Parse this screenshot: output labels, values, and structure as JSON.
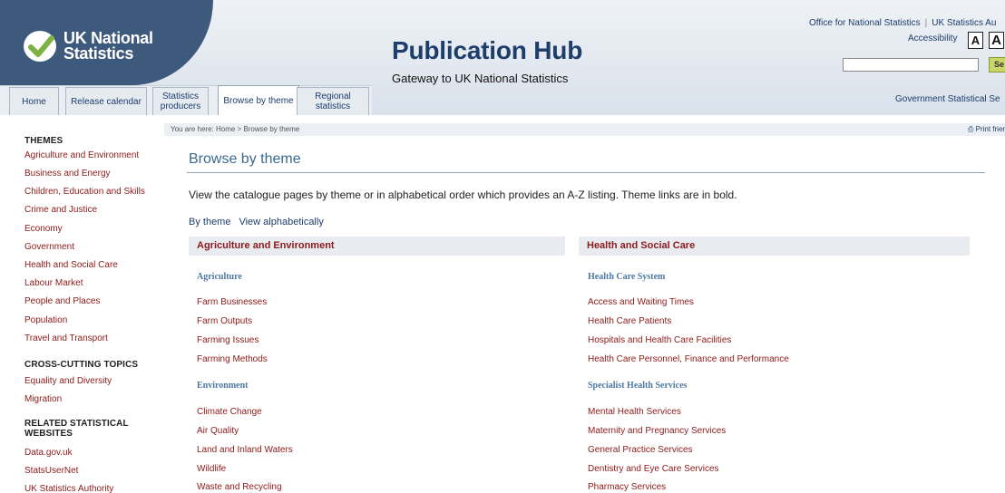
{
  "header": {
    "logo_line1": "UK National",
    "logo_line2": "Statistics",
    "title": "Publication Hub",
    "subtitle": "Gateway to UK National Statistics",
    "top_link_ons": "Office for National Statistics",
    "top_link_uksa": "UK Statistics Au",
    "accessibility_label": "Accessibility",
    "font_small": "A",
    "font_large": "A",
    "search_value": "",
    "search_button": "Se",
    "gss_link": "Government Statistical Se"
  },
  "tabs": [
    {
      "label": "Home"
    },
    {
      "label": "Release calendar"
    },
    {
      "label": "Statistics producers"
    },
    {
      "label": "Browse by theme"
    },
    {
      "label": "Regional statistics"
    }
  ],
  "sidebar": {
    "themes_heading": "THEMES",
    "themes": [
      "Agriculture and Environment",
      "Business and Energy",
      "Children, Education and Skills",
      "Crime and Justice",
      "Economy",
      "Government",
      "Health and Social Care",
      "Labour Market",
      "People and Places",
      "Population",
      "Travel and Transport"
    ],
    "cross_heading": "CROSS-CUTTING TOPICS",
    "cross": [
      "Equality and Diversity",
      "Migration"
    ],
    "related_heading_1": "RELATED STATISTICAL",
    "related_heading_2": "WEBSITES",
    "related": [
      "Data.gov.uk",
      "StatsUserNet",
      "UK Statistics Authority"
    ]
  },
  "main": {
    "breadcrumb": "You are here: Home > Browse by theme",
    "print_link": "Print frien",
    "page_title": "Browse by theme",
    "intro": "View the catalogue pages by theme or in alphabetical order which provides an A-Z listing. Theme links are in bold.",
    "view_by_theme": "By theme",
    "view_alpha": "View alphabetically",
    "col1": {
      "heading": "Agriculture and Environment",
      "groups": [
        {
          "title": "Agriculture",
          "items": [
            "Farm Businesses",
            "Farm Outputs",
            "Farming Issues",
            "Farming Methods"
          ]
        },
        {
          "title": "Environment",
          "items": [
            "Climate Change",
            "Air Quality",
            "Land and Inland Waters",
            "Wildlife",
            "Waste and Recycling"
          ]
        }
      ]
    },
    "col2": {
      "heading": "Health and Social Care",
      "groups": [
        {
          "title": "Health Care System",
          "items": [
            "Access and Waiting Times",
            "Health Care Patients",
            "Hospitals and Health Care Facilities",
            "Health Care Personnel, Finance and Performance"
          ]
        },
        {
          "title": "Specialist Health Services",
          "items": [
            "Mental Health Services",
            "Maternity and Pregnancy Services",
            "General Practice Services",
            "Dentistry and Eye Care Services",
            "Pharmacy Services"
          ]
        }
      ]
    }
  }
}
